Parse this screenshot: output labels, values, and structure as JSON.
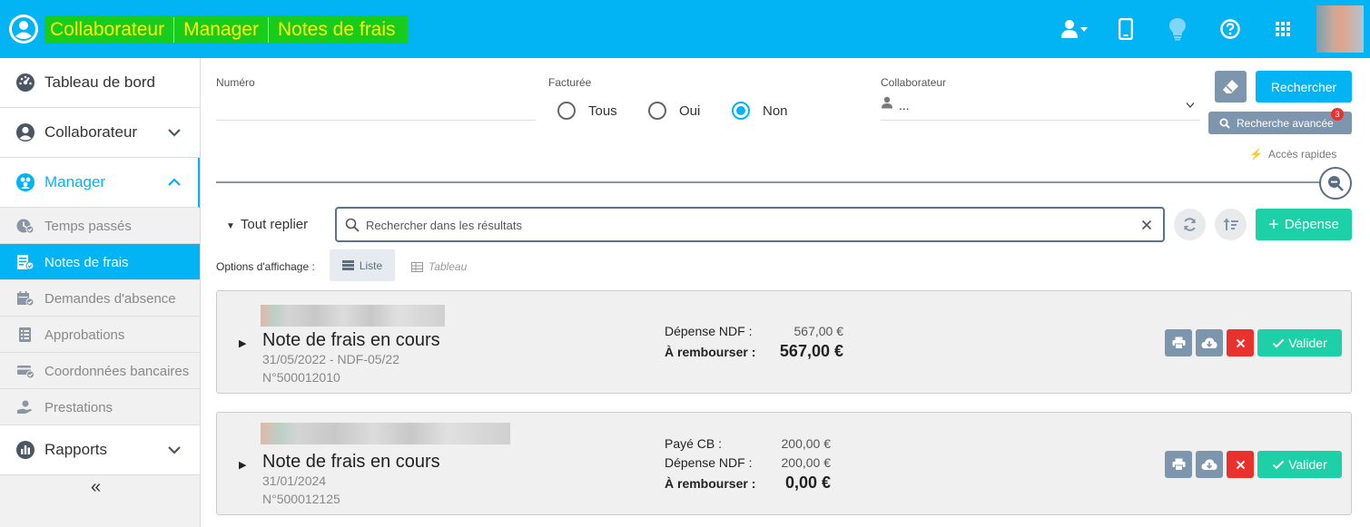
{
  "header": {
    "breadcrumbs": [
      "Collaborateur",
      "Manager",
      "Notes de frais"
    ],
    "icons": [
      "user-switch-icon",
      "mobile-icon",
      "lightbulb-icon",
      "help-icon",
      "apps-grid-icon"
    ],
    "colors": {
      "bar": "#03b4f4",
      "crumb_bg": "#17cc1d",
      "crumb_text": "#fff20b"
    }
  },
  "sidebar": {
    "main_items": [
      {
        "label": "Tableau de bord"
      },
      {
        "label": "Collaborateur"
      },
      {
        "label": "Manager"
      },
      {
        "label": "Rapports"
      }
    ],
    "sub_items": [
      {
        "label": "Temps passés"
      },
      {
        "label": "Notes de frais"
      },
      {
        "label": "Demandes d'absence"
      },
      {
        "label": "Approbations"
      },
      {
        "label": "Coordonnées bancaires"
      },
      {
        "label": "Prestations"
      }
    ],
    "active_sub": "Notes de frais",
    "collapse_label": "«"
  },
  "filters": {
    "numero_label": "Numéro",
    "numero_value": "",
    "facturee_label": "Facturée",
    "options": [
      "Tous",
      "Oui",
      "Non"
    ],
    "selected": "Non",
    "collaborateur_label": "Collaborateur",
    "collaborateur_value": "...",
    "search_button": "Rechercher",
    "advanced_button": "Recherche avancée",
    "advanced_badge": "3",
    "quick_access": "Accès rapides"
  },
  "results": {
    "fold_label": "Tout replier",
    "search_placeholder": "Rechercher dans les résultats",
    "add_button": "Dépense",
    "display_options_label": "Options d'affichage :",
    "view_list": "Liste",
    "view_table": "Tableau"
  },
  "cards": [
    {
      "title": "Note de frais en cours",
      "date_ref": "31/05/2022 - NDF-05/22",
      "number": "N°500012010",
      "lines": [
        {
          "label": "Dépense NDF :",
          "value": "567,00 €"
        }
      ],
      "total_label": "À rembourser :",
      "total_value": "567,00 €",
      "validate_label": "Valider"
    },
    {
      "title": "Note de frais en cours",
      "date_ref": "31/01/2024",
      "number": "N°500012125",
      "lines": [
        {
          "label": "Payé CB :",
          "value": "200,00 €"
        },
        {
          "label": "Dépense NDF :",
          "value": "200,00 €"
        }
      ],
      "total_label": "À rembourser :",
      "total_value": "0,00 €",
      "validate_label": "Valider"
    }
  ]
}
